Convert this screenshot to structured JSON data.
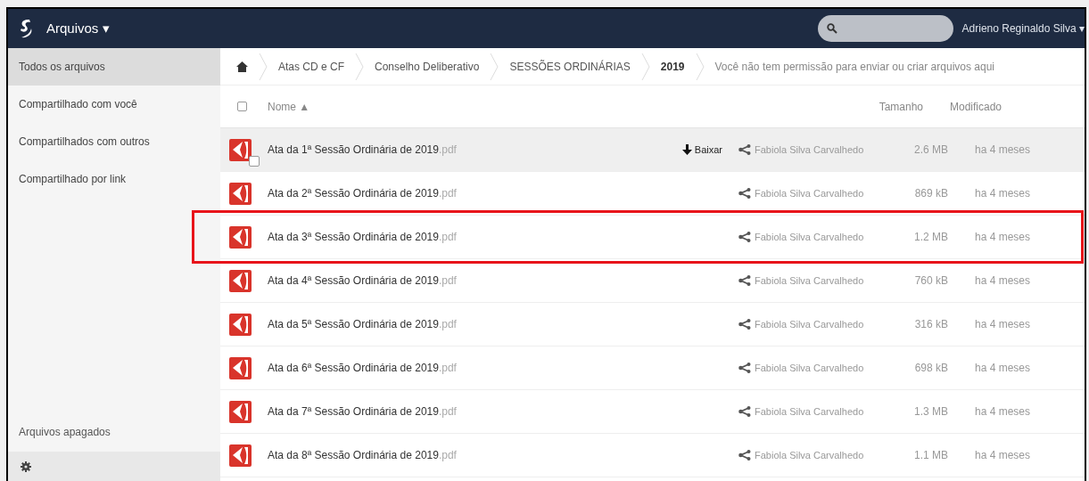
{
  "header": {
    "app_menu": "Arquivos ▾",
    "user_menu": "Adrieno Reginaldo Silva ▾"
  },
  "sidebar": {
    "items": [
      {
        "label": "Todos os arquivos",
        "selected": true
      },
      {
        "label": "Compartilhado com você",
        "selected": false
      },
      {
        "label": "Compartilhados com outros",
        "selected": false
      },
      {
        "label": "Compartilhado por link",
        "selected": false
      }
    ],
    "footer_item": "Arquivos apagados"
  },
  "breadcrumb": {
    "items": [
      "Atas CD e CF",
      "Conselho Deliberativo",
      "SESSÕES ORDINÁRIAS",
      "2019"
    ],
    "notice": "Você não tem permissão para enviar ou criar arquivos aqui"
  },
  "table": {
    "select_all": {
      "checked": false
    },
    "columns": [
      "Nome ▲",
      "Tamanho",
      "Modificado"
    ],
    "rows": [
      {
        "name": "Ata da 1ª Sessão Ordinária de 2019",
        "ext": ".pdf",
        "hovered": true,
        "highlighted": false,
        "download": "Baixar",
        "shared_by": "Fabiola Silva Carvalhedo",
        "size": "2.6 MB",
        "modified": "ha 4 meses"
      },
      {
        "name": "Ata da 2ª Sessão Ordinária de 2019",
        "ext": ".pdf",
        "hovered": false,
        "highlighted": false,
        "shared_by": "Fabiola Silva Carvalhedo",
        "size": "869 kB",
        "modified": "ha 4 meses"
      },
      {
        "name": "Ata da 3ª Sessão Ordinária de 2019",
        "ext": ".pdf",
        "hovered": false,
        "highlighted": true,
        "shared_by": "Fabiola Silva Carvalhedo",
        "size": "1.2 MB",
        "modified": "ha 4 meses"
      },
      {
        "name": "Ata da 4ª Sessão Ordinária de 2019",
        "ext": ".pdf",
        "hovered": false,
        "highlighted": false,
        "shared_by": "Fabiola Silva Carvalhedo",
        "size": "760 kB",
        "modified": "ha 4 meses"
      },
      {
        "name": "Ata da 5ª Sessão Ordinária de 2019",
        "ext": ".pdf",
        "hovered": false,
        "highlighted": false,
        "shared_by": "Fabiola Silva Carvalhedo",
        "size": "316 kB",
        "modified": "ha 4 meses"
      },
      {
        "name": "Ata da 6ª Sessão Ordinária de 2019",
        "ext": ".pdf",
        "hovered": false,
        "highlighted": false,
        "shared_by": "Fabiola Silva Carvalhedo",
        "size": "698 kB",
        "modified": "ha 4 meses"
      },
      {
        "name": "Ata da 7ª Sessão Ordinária de 2019",
        "ext": ".pdf",
        "hovered": false,
        "highlighted": false,
        "shared_by": "Fabiola Silva Carvalhedo",
        "size": "1.3 MB",
        "modified": "ha 4 meses"
      },
      {
        "name": "Ata da 8ª Sessão Ordinária de 2019",
        "ext": ".pdf",
        "hovered": false,
        "highlighted": false,
        "shared_by": "Fabiola Silva Carvalhedo",
        "size": "1.1 MB",
        "modified": "ha 4 meses"
      }
    ]
  }
}
